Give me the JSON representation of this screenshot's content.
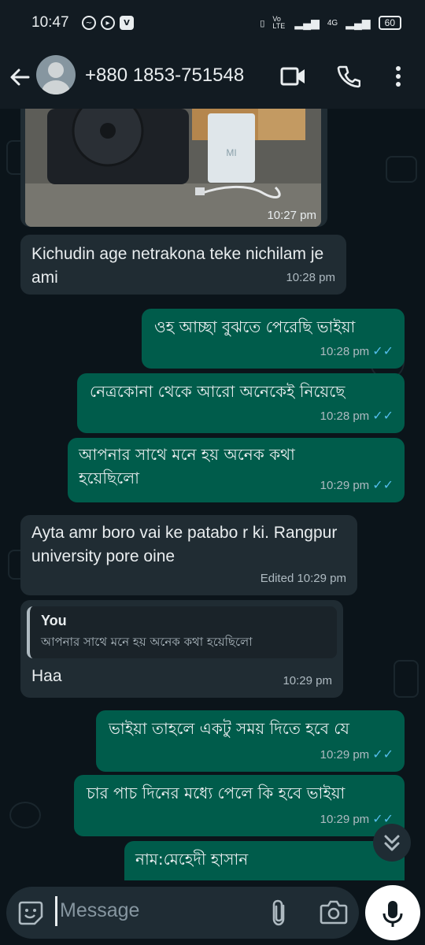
{
  "status_bar": {
    "time": "10:47",
    "network": "4G",
    "volte": "Vo LTE",
    "battery": "60"
  },
  "header": {
    "contact_name": "+880 1853-751548"
  },
  "messages": [
    {
      "dir": "in",
      "type": "image",
      "time": "10:27 pm"
    },
    {
      "dir": "in",
      "text": "Kichudin age netrakona teke nichilam je ami",
      "time": "10:28 pm"
    },
    {
      "dir": "out",
      "text": "ওহ আচ্ছা বুঝতে পেরেছি ভাইয়া",
      "time": "10:28 pm"
    },
    {
      "dir": "out",
      "text": "নেত্রকোনা থেকে আরো অনেকেই নিয়েছে",
      "time": "10:28 pm"
    },
    {
      "dir": "out",
      "text": "আপনার সাথে মনে হয় অনেক কথা হয়েছিলো",
      "time": "10:29 pm"
    },
    {
      "dir": "in",
      "text": "Ayta amr boro vai ke patabo r ki. Rangpur university pore oine",
      "time": "Edited 10:29 pm"
    },
    {
      "dir": "in",
      "quote_author": "You",
      "quote_text": "আপনার সাথে মনে হয় অনেক কথা হয়েছিলো",
      "text": "Haa",
      "time": "10:29 pm"
    },
    {
      "dir": "out",
      "text": "ভাইয়া তাহলে একটু সময় দিতে হবে যে",
      "time": "10:29 pm"
    },
    {
      "dir": "out",
      "text": "চার পাচ দিনের মধ্যে পেলে কি হবে ভাইয়া",
      "time": "10:29 pm"
    },
    {
      "dir": "out",
      "text": "নাম:মেহেদী হাসান",
      "time": ""
    }
  ],
  "photo": {
    "label": "MI"
  },
  "input": {
    "placeholder": "Message"
  },
  "icons": {
    "back": "arrow-left-icon",
    "video": "video-call-icon",
    "call": "phone-icon",
    "menu": "more-vert-icon",
    "emoji": "emoji-icon",
    "attach": "paperclip-icon",
    "camera": "camera-icon",
    "mic": "mic-icon",
    "scroll": "double-chevron-down-icon"
  },
  "colors": {
    "incoming": "#202c33",
    "outgoing": "#005c4b",
    "read_ticks": "#53bdeb",
    "background": "#0b141a"
  }
}
